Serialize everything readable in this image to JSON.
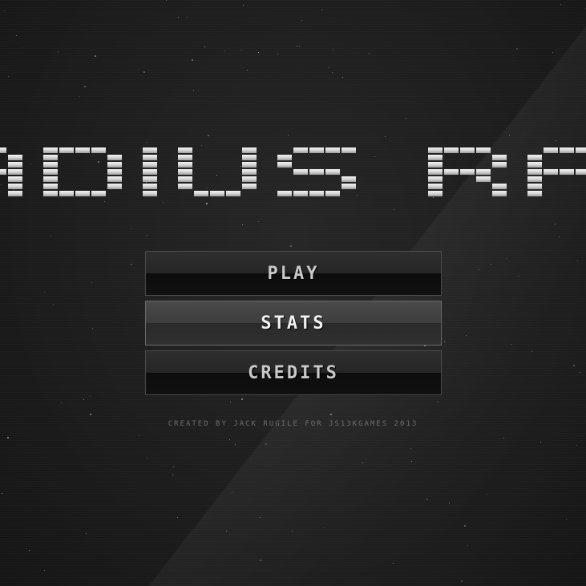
{
  "game": {
    "title": "RADIUS RAID"
  },
  "menu": {
    "items": [
      {
        "label": "PLAY",
        "active": false
      },
      {
        "label": "STATS",
        "active": true
      },
      {
        "label": "CREDITS",
        "active": false
      }
    ]
  },
  "footer": {
    "credit": "CREATED BY JACK RUGILE FOR JS13KGAMES 2013"
  },
  "colors": {
    "background": "#1d1d1d",
    "title_light": "#f0f0f0",
    "title_dark": "#8a8a8a",
    "button_text": "#c9c9c9",
    "button_text_active": "#f2f2f2",
    "credit_text": "#6e6e6e"
  }
}
